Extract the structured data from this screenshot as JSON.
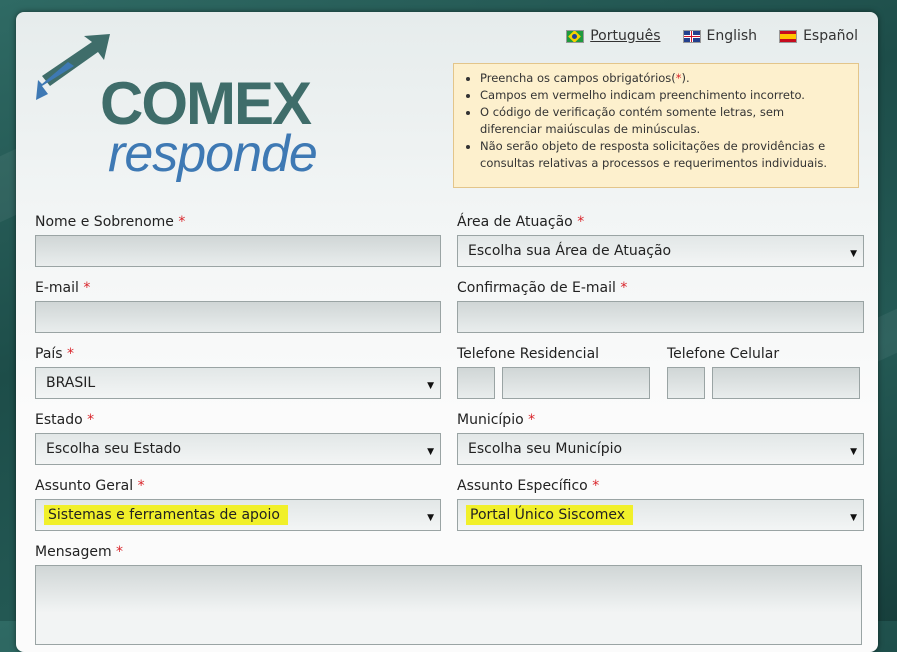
{
  "languages": [
    {
      "label": "Português",
      "active": true
    },
    {
      "label": "English",
      "active": false
    },
    {
      "label": "Español",
      "active": false
    }
  ],
  "logo": {
    "line1": "COMEX",
    "line2": "responde"
  },
  "notice": {
    "items": [
      "Preencha os campos obrigatórios(*).",
      "Campos em vermelho indicam preenchimento incorreto.",
      "O código de verificação contém somente letras, sem diferenciar maiúsculas de minúsculas.",
      "Não serão objeto de resposta solicitações de providências e consultas relativas a processos e requerimentos individuais."
    ]
  },
  "form": {
    "required_mark": "*",
    "nome_label": "Nome e Sobrenome",
    "area_label": "Área de Atuação",
    "area_value": "Escolha sua Área de Atuação",
    "email_label": "E-mail",
    "email_confirm_label": "Confirmação de E-mail",
    "pais_label": "País",
    "pais_value": "BRASIL",
    "tel_res_label": "Telefone Residencial",
    "tel_cel_label": "Telefone Celular",
    "estado_label": "Estado",
    "estado_value": "Escolha seu Estado",
    "municipio_label": "Município",
    "municipio_value": "Escolha seu Município",
    "assunto_geral_label": "Assunto Geral",
    "assunto_geral_value": "Sistemas e ferramentas de apoio",
    "assunto_especifico_label": "Assunto Específico",
    "assunto_especifico_value": "Portal Único Siscomex",
    "mensagem_label": "Mensagem"
  },
  "colors": {
    "required": "#d9242a",
    "highlight": "#f1f02a",
    "brand_green": "#3f6d6a",
    "brand_blue": "#3e79b4"
  }
}
